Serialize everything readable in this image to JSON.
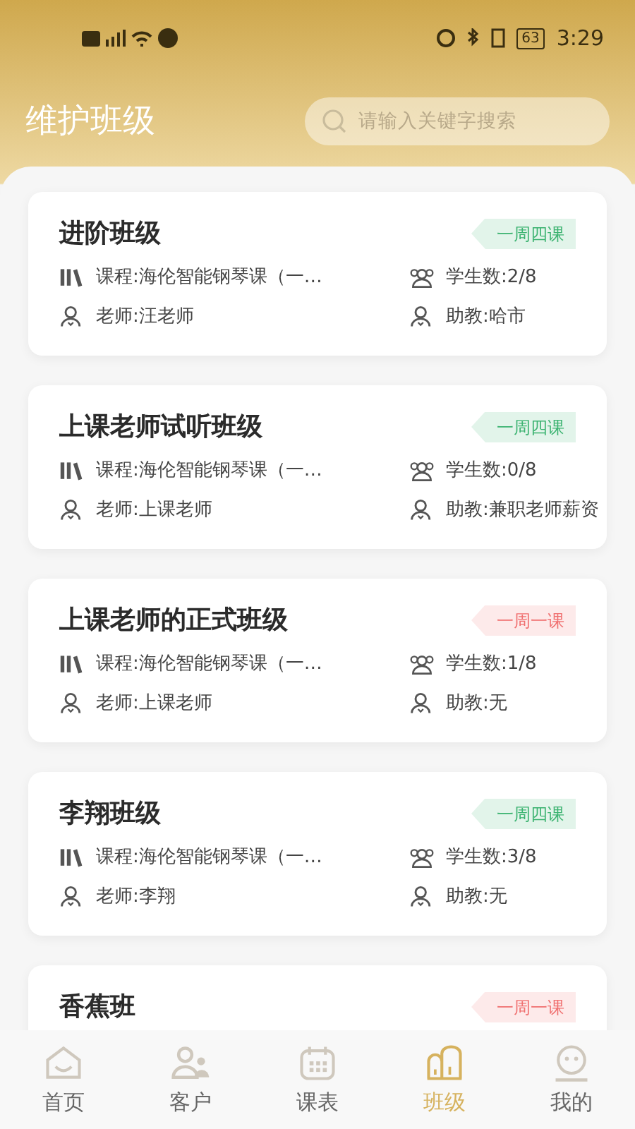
{
  "status_bar": {
    "battery": "63",
    "time": "3:29"
  },
  "header": {
    "title": "维护班级",
    "search": {
      "placeholder": "请输入关键字搜索"
    }
  },
  "classes": [
    {
      "name": "进阶班级",
      "tag": {
        "text": "一周四课",
        "color": "#3cb371"
      },
      "course": "课程:海伦智能钢琴课（一…",
      "students": "学生数:2/8",
      "teacher": "老师:汪老师",
      "assistant": "助教:哈市"
    },
    {
      "name": "上课老师试听班级",
      "tag": {
        "text": "一周四课",
        "color": "#3cb371"
      },
      "course": "课程:海伦智能钢琴课（一…",
      "students": "学生数:0/8",
      "teacher": "老师:上课老师",
      "assistant": "助教:兼职老师薪资"
    },
    {
      "name": "上课老师的正式班级",
      "tag": {
        "text": "一周一课",
        "color": "#f07070"
      },
      "course": "课程:海伦智能钢琴课（一…",
      "students": "学生数:1/8",
      "teacher": "老师:上课老师",
      "assistant": "助教:无"
    },
    {
      "name": "李翔班级",
      "tag": {
        "text": "一周四课",
        "color": "#3cb371"
      },
      "course": "课程:海伦智能钢琴课（一…",
      "students": "学生数:3/8",
      "teacher": "老师:李翔",
      "assistant": "助教:无"
    },
    {
      "name": "香蕉班",
      "tag": {
        "text": "一周一课",
        "color": "#f07070"
      }
    }
  ],
  "tab_bar": [
    {
      "kind": "home",
      "label": "首页",
      "selected": false
    },
    {
      "kind": "customers",
      "label": "客户",
      "selected": false
    },
    {
      "kind": "schedule",
      "label": "课表",
      "selected": false
    },
    {
      "kind": "classes",
      "label": "班级",
      "selected": true
    },
    {
      "kind": "profile",
      "label": "我的",
      "selected": false
    }
  ]
}
